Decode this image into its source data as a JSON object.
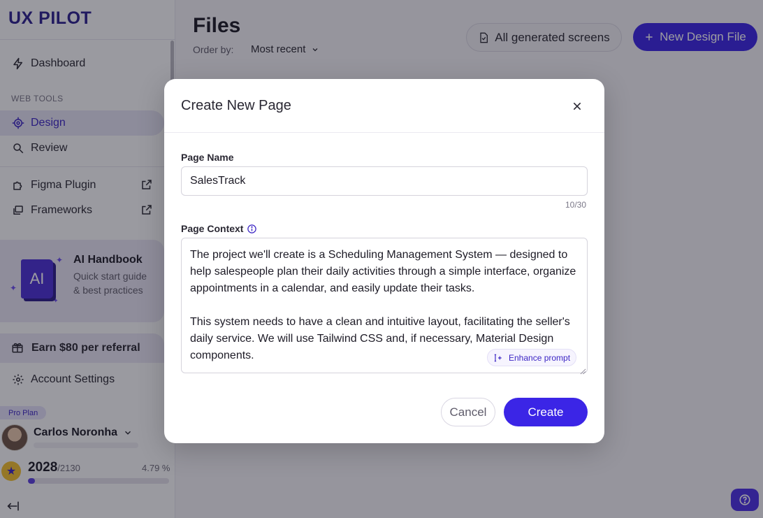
{
  "sidebar": {
    "logo": "UX PILOT",
    "dashboard_label": "Dashboard",
    "section_label": "WEB TOOLS",
    "design_label": "Design",
    "review_label": "Review",
    "figma_label": "Figma Plugin",
    "frameworks_label": "Frameworks",
    "handbook": {
      "book_text": "AI",
      "title": "AI Handbook",
      "subtitle": "Quick start guide & best practices"
    },
    "referral_label": "Earn $80 per referral",
    "account_label": "Account Settings",
    "plan_badge": "Pro Plan",
    "user_name": "Carlos Noronha",
    "credits_used": "2028",
    "credits_total": "/2130",
    "credits_percent_label": "4.79 %",
    "credits_progress_fraction": 0.05
  },
  "main": {
    "title": "Files",
    "order_label": "Order by:",
    "order_value": "Most recent",
    "all_screens_label": "All generated screens",
    "new_file_label": "New Design File"
  },
  "modal": {
    "title": "Create New Page",
    "page_name_label": "Page Name",
    "page_name_value": "SalesTrack",
    "page_name_counter": "10/30",
    "context_label": "Page Context",
    "context_value": "The project we'll create is a Scheduling Management System — designed to help salespeople plan their daily activities through a simple interface, organize appointments in a calendar, and easily update their tasks.\n\nThis system needs to have a clean and intuitive layout, facilitating the seller's daily service. We will use Tailwind CSS and, if necessary, Material Design components.",
    "enhance_label": "Enhance prompt",
    "cancel_label": "Cancel",
    "create_label": "Create"
  },
  "colors": {
    "accent": "#3b25e6",
    "logo": "#2b1f8f",
    "active_bg": "#e6e3f5"
  }
}
